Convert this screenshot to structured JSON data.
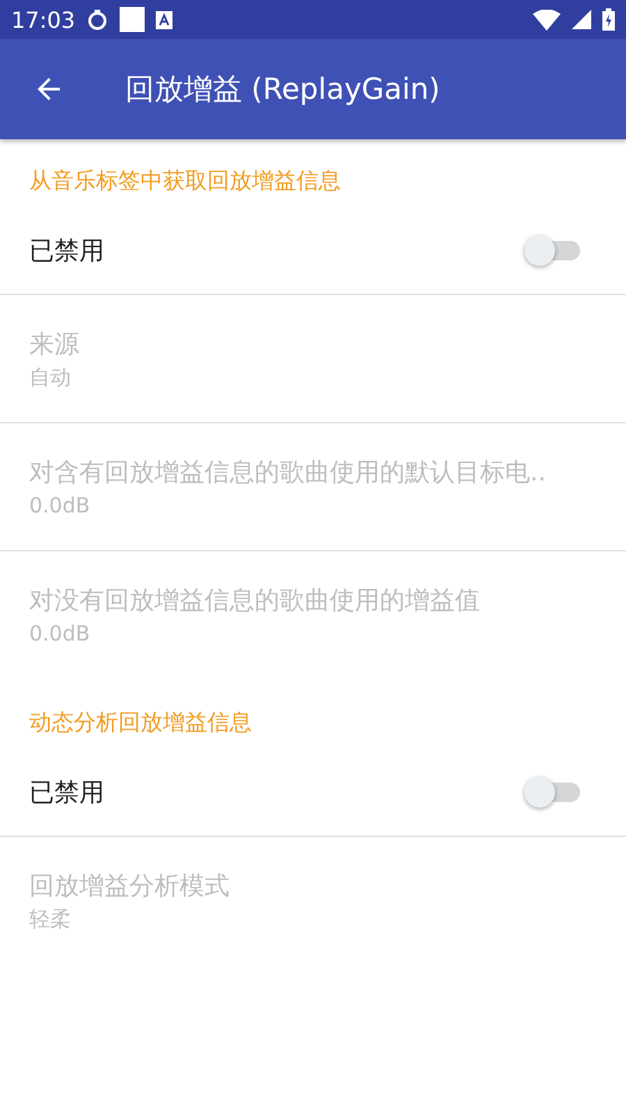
{
  "status_bar": {
    "time": "17:03"
  },
  "app_bar": {
    "title": "回放增益 (ReplayGain)"
  },
  "sections": [
    {
      "header": "从音乐标签中获取回放增益信息",
      "items": [
        {
          "kind": "switch",
          "title": "已禁用",
          "on": false,
          "disabled": false
        },
        {
          "kind": "pref",
          "title": "来源",
          "summary": "自动",
          "disabled": true
        },
        {
          "kind": "pref",
          "title": "对含有回放增益信息的歌曲使用的默认目标电..",
          "summary": "0.0dB",
          "disabled": true
        },
        {
          "kind": "pref",
          "title": "对没有回放增益信息的歌曲使用的增益值",
          "summary": "0.0dB",
          "disabled": true
        }
      ]
    },
    {
      "header": "动态分析回放增益信息",
      "items": [
        {
          "kind": "switch",
          "title": "已禁用",
          "on": false,
          "disabled": false
        },
        {
          "kind": "pref",
          "title": "回放增益分析模式",
          "summary": "轻柔",
          "disabled": true
        }
      ]
    }
  ]
}
